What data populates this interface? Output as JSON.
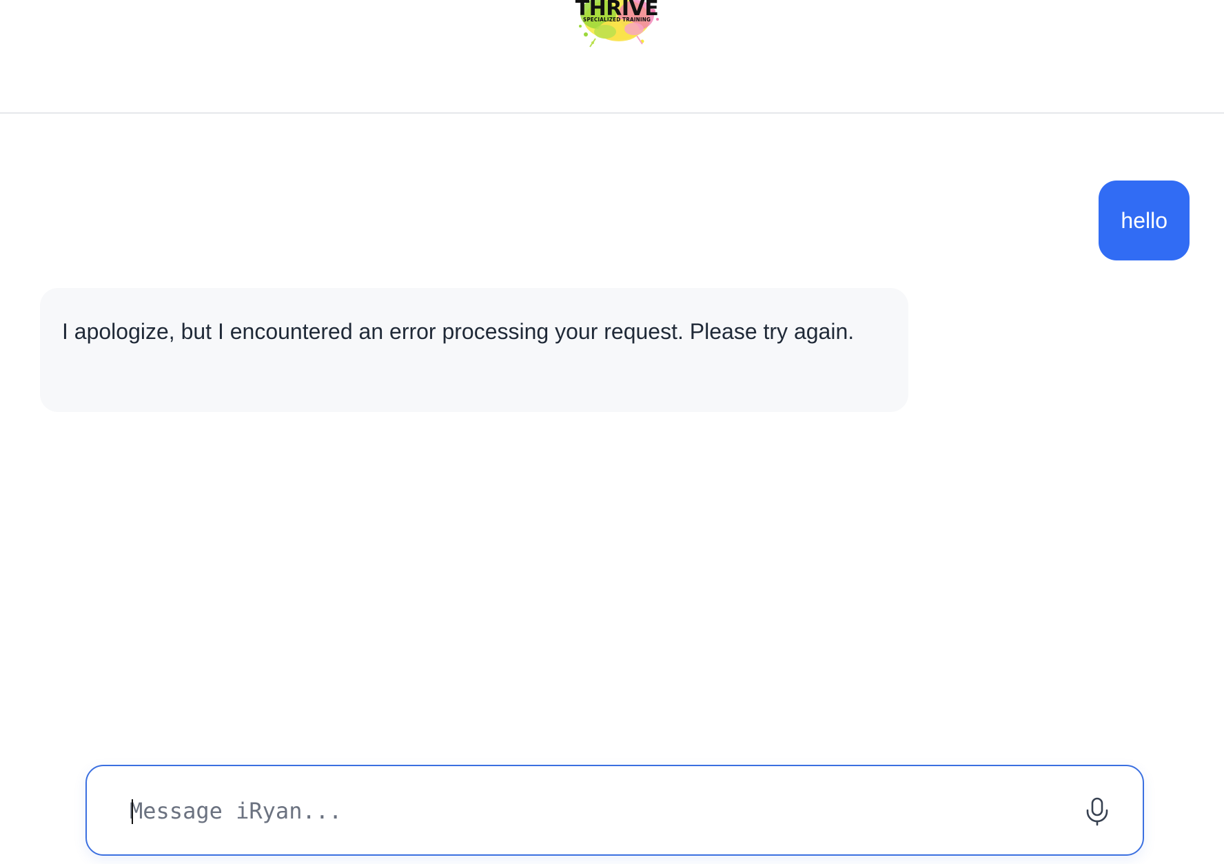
{
  "header": {
    "logo": {
      "name": "THRIVE",
      "subtitle": "SPECIALIZED TRAINING",
      "icon": "paint-splash-logo"
    }
  },
  "conversation": {
    "messages": [
      {
        "role": "user",
        "text": "hello"
      },
      {
        "role": "assistant",
        "text": "I apologize, but I encountered an error processing your request. Please try again."
      }
    ]
  },
  "composer": {
    "placeholder": "Message iRyan...",
    "value": "",
    "mic_icon": "microphone-icon"
  },
  "colors": {
    "user_bubble": "#316cf4",
    "assistant_bubble": "#f7f8fa",
    "composer_border": "#3a6fe0"
  }
}
